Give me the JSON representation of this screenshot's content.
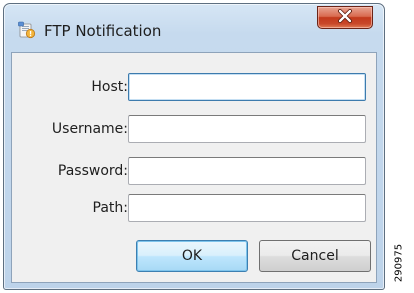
{
  "window": {
    "title": "FTP Notification",
    "app_icon": "ftp-notification-icon",
    "close_icon": "close-x-icon",
    "close_glyph": "X"
  },
  "form": {
    "fields": [
      {
        "label": "Host:",
        "value": "",
        "focused": true
      },
      {
        "label": "Username:",
        "value": "",
        "focused": false
      },
      {
        "label": "Password:",
        "value": "",
        "focused": false
      },
      {
        "label": "Path:",
        "value": "",
        "focused": false
      }
    ]
  },
  "buttons": {
    "ok_label": "OK",
    "cancel_label": "Cancel"
  },
  "figure_id": "290975",
  "colors": {
    "frame": "#c6daee",
    "close_button": "#c8482a",
    "focus_border": "#3d7bad",
    "client_bg": "#f0f0f0"
  }
}
